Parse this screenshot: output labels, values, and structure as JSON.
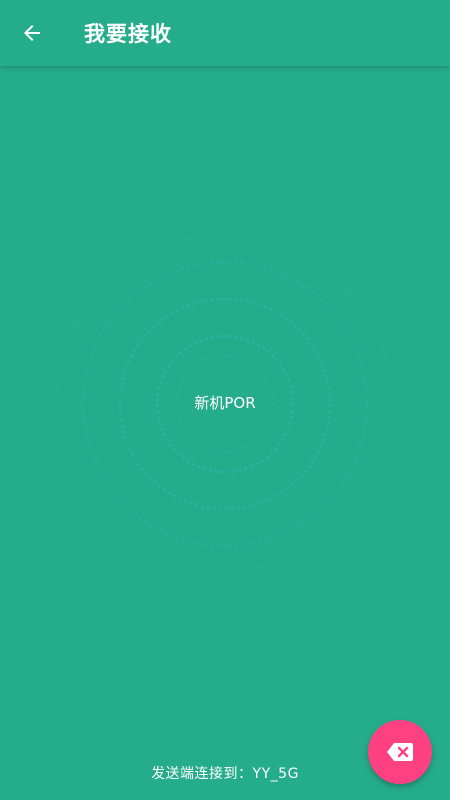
{
  "app_bar": {
    "title": "我要接收",
    "back_icon": "arrow-left-icon"
  },
  "radar": {
    "device_label": "新机POR"
  },
  "footer": {
    "status_text": "发送端连接到：YY_5G"
  },
  "fab": {
    "icon": "backspace-close-icon"
  },
  "colors": {
    "background": "#25ad8b",
    "ring": "#2cb6a0",
    "fab": "#ff4081",
    "text": "#ffffff"
  }
}
